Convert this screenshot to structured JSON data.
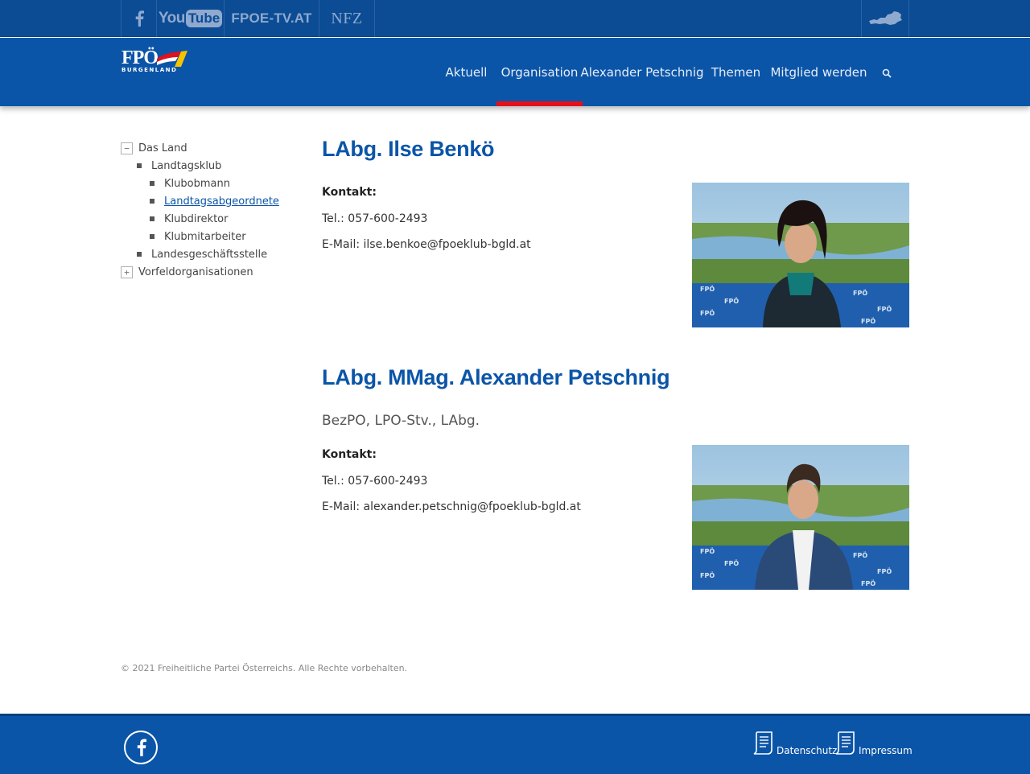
{
  "topbar": {
    "social": [
      {
        "name": "facebook",
        "icon": "facebook-icon"
      },
      {
        "name": "youtube",
        "you": "You",
        "tube": "Tube"
      },
      {
        "name": "fpoe-tv",
        "label": "FPOE-TV.AT"
      },
      {
        "name": "nfz",
        "label": "NFZ"
      }
    ],
    "austria_icon": "austria-map-icon"
  },
  "header": {
    "logo_text": "FPÖ",
    "logo_sub": "BURGENLAND",
    "nav": [
      "Aktuell",
      "Organisation",
      "Alexander Petschnig",
      "Themen",
      "Mitglied werden"
    ],
    "active_nav": "Organisation",
    "search_icon": "search-icon",
    "colors": {
      "primary": "#0b55a8",
      "accent_red": "#e3101c",
      "flag_yellow": "#f5c400"
    }
  },
  "sidebar": {
    "items": [
      {
        "label": "Das Land",
        "toggle": "−",
        "level": 0
      },
      {
        "label": "Landtagsklub",
        "level": 1
      },
      {
        "label": "Klubobmann",
        "level": 2
      },
      {
        "label": "Landtagsabgeordnete",
        "level": 2,
        "current": true
      },
      {
        "label": "Klubdirektor",
        "level": 2
      },
      {
        "label": "Klubmitarbeiter",
        "level": 2
      },
      {
        "label": "Landesgeschäftsstelle",
        "level": 1
      },
      {
        "label": "Vorfeldorganisationen",
        "toggle": "+",
        "level": 0
      }
    ]
  },
  "persons": [
    {
      "name": "LAbg. Ilse Benkö",
      "kontakt": "Kontakt:",
      "tel": "Tel.: 057-600-2493",
      "email": "E-Mail: ilse.benkoe@fpoeklub-bgld.at"
    },
    {
      "name": "LAbg. MMag. Alexander Petschnig",
      "role": "BezPO, LPO-Stv., LAbg.",
      "kontakt": "Kontakt:",
      "tel": "Tel.: 057-600-2493",
      "email": "E-Mail: alexander.petschnig@fpoeklub-bgld.at"
    }
  ],
  "footer": {
    "copyright": "© 2021 Freiheitliche Partei Österreichs. Alle Rechte vorbehalten.",
    "links": [
      "Datenschutz",
      "Impressum"
    ],
    "facebook_icon": "facebook-icon"
  }
}
